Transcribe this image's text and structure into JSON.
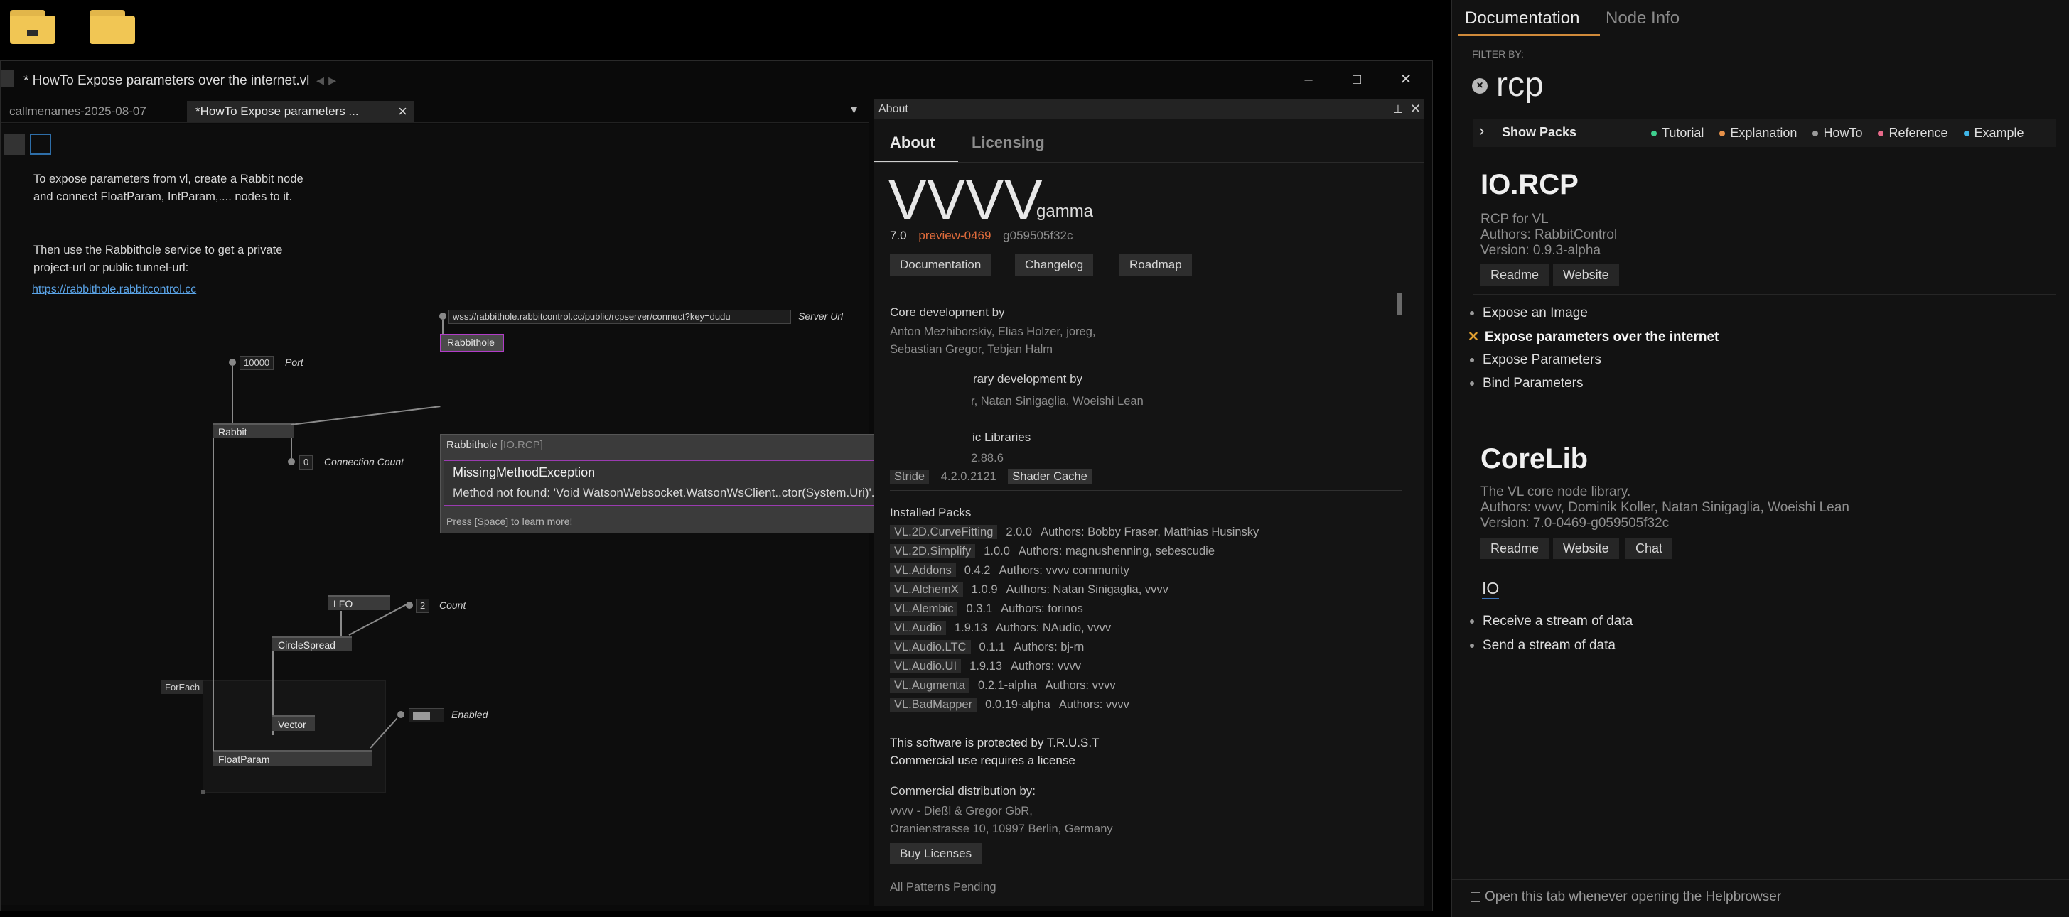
{
  "desktop": {
    "icons": [
      "folder-icon",
      "folder-icon"
    ]
  },
  "window": {
    "title": "* HowTo Expose parameters over the internet.vl",
    "title_arrow": "◂ ▸",
    "tabs": [
      "callmenames-2025-08-07",
      "*HowTo Expose parameters ..."
    ],
    "tab_close": "×",
    "tab_dropdown": "▾"
  },
  "patch": {
    "comment1": "To expose parameters from vl, create a Rabbit node and connect FloatParam, IntParam,.... nodes to it.",
    "comment2": "Then use the Rabbithole service to get a private project-url or public tunnel-url:",
    "link": "https://rabbithole.rabbitcontrol.cc",
    "server_url_value": "wss://rabbithole.rabbitcontrol.cc/public/rcpserver/connect?key=dudu",
    "server_url_label": "Server Url",
    "rabbithole_node": "Rabbithole",
    "port_value": "10000",
    "port_label": "Port",
    "rabbit_node": "Rabbit",
    "connection_count_value": "0",
    "connection_count_label": "Connection Count",
    "lfo_node": "LFO",
    "count_value": "2",
    "count_label": "Count",
    "circlespread_node": "CircleSpread",
    "foreach_label": "ForEach",
    "vector_node": "Vector",
    "enabled_label": "Enabled",
    "floatparam_node": "FloatParam"
  },
  "tooltip": {
    "header": "Rabbithole",
    "header_category": "[IO.RCP]",
    "error_title": "MissingMethodException",
    "error_message": "Method not found: 'Void WatsonWebsocket.WatsonWsClient..ctor(System.Uri)'.",
    "hint": "Press [Space] to learn more!"
  },
  "about": {
    "panel_title": "About",
    "tabs": [
      "About",
      "Licensing"
    ],
    "product": "VVVV",
    "product_suffix": "gamma",
    "version": "7.0",
    "preview": "preview-0469",
    "commit": "g059505f32c",
    "buttons": [
      "Documentation",
      "Changelog",
      "Roadmap"
    ],
    "core_dev_heading": "Core development by",
    "core_dev_line1": "Anton Mezhiborskiy, Elias Holzer, joreg,",
    "core_dev_line2": "Sebastian Gregor, Tebjan Halm",
    "library_dev_heading": "rary development by",
    "library_dev_line": "r, Natan Sinigaglia, Woeishi Lean",
    "public_libs_heading": "ic Libraries",
    "libs": [
      {
        "name": "",
        "version": "2.88.6"
      },
      {
        "name": "Stride",
        "version": "4.2.0.2121",
        "extra": "Shader Cache"
      }
    ],
    "installed_heading": "Installed Packs",
    "packs": [
      {
        "name": "VL.2D.CurveFitting",
        "version": "2.0.0",
        "authors": "Authors: Bobby Fraser, Matthias Husinsky"
      },
      {
        "name": "VL.2D.Simplify",
        "version": "1.0.0",
        "authors": "Authors: magnushenning, sebescudie"
      },
      {
        "name": "VL.Addons",
        "version": "0.4.2",
        "authors": "Authors: vvvv community"
      },
      {
        "name": "VL.AlchemX",
        "version": "1.0.9",
        "authors": "Authors: Natan Sinigaglia, vvvv"
      },
      {
        "name": "VL.Alembic",
        "version": "0.3.1",
        "authors": "Authors: torinos"
      },
      {
        "name": "VL.Audio",
        "version": "1.9.13",
        "authors": "Authors: NAudio, vvvv"
      },
      {
        "name": "VL.Audio.LTC",
        "version": "0.1.1",
        "authors": "Authors: bj-rn"
      },
      {
        "name": "VL.Audio.UI",
        "version": "1.9.13",
        "authors": "Authors: vvvv"
      },
      {
        "name": "VL.Augmenta",
        "version": "0.2.1-alpha",
        "authors": "Authors: vvvv"
      },
      {
        "name": "VL.BadMapper",
        "version": "0.0.19-alpha",
        "authors": "Authors: vvvv"
      }
    ],
    "protected_line1": "This software is protected by T.R.U.S.T",
    "protected_line2": "Commercial use requires a license",
    "distribution_heading": "Commercial distribution by:",
    "distribution_line1": "vvvv - Dießl & Gregor GbR,",
    "distribution_line2": "Oranienstrasse 10, 10997 Berlin, Germany",
    "buy_button": "Buy Licenses",
    "footer": "All Patterns Pending"
  },
  "help": {
    "tabs": [
      "Documentation",
      "Node Info"
    ],
    "filter_label": "FILTER BY:",
    "filter_value": "rcp",
    "show_packs": "Show Packs",
    "legend": [
      {
        "label": "Tutorial",
        "color": "#3ecf8e"
      },
      {
        "label": "Explanation",
        "color": "#e8924a"
      },
      {
        "label": "HowTo",
        "color": "#9a9a9a"
      },
      {
        "label": "Reference",
        "color": "#e86a8a"
      },
      {
        "label": "Example",
        "color": "#3fb6e8"
      }
    ],
    "pack1": {
      "title": "IO.RCP",
      "desc": "RCP for VL",
      "authors": "Authors: RabbitControl",
      "version": "Version: 0.9.3-alpha",
      "buttons": [
        "Readme",
        "Website"
      ],
      "items": [
        "Expose an Image",
        "Expose parameters over the internet",
        "Expose Parameters",
        "Bind Parameters"
      ]
    },
    "pack2": {
      "title": "CoreLib",
      "desc": "The VL core node library.",
      "authors": "Authors: vvvv, Dominik Koller, Natan Sinigaglia, Woeishi Lean",
      "version": "Version: 7.0-0469-g059505f32c",
      "buttons": [
        "Readme",
        "Website",
        "Chat"
      ],
      "category": "IO",
      "items": [
        "Receive a stream of data",
        "Send a stream of data"
      ]
    },
    "footer_checkbox": "Open this tab whenever opening the Helpbrowser"
  }
}
